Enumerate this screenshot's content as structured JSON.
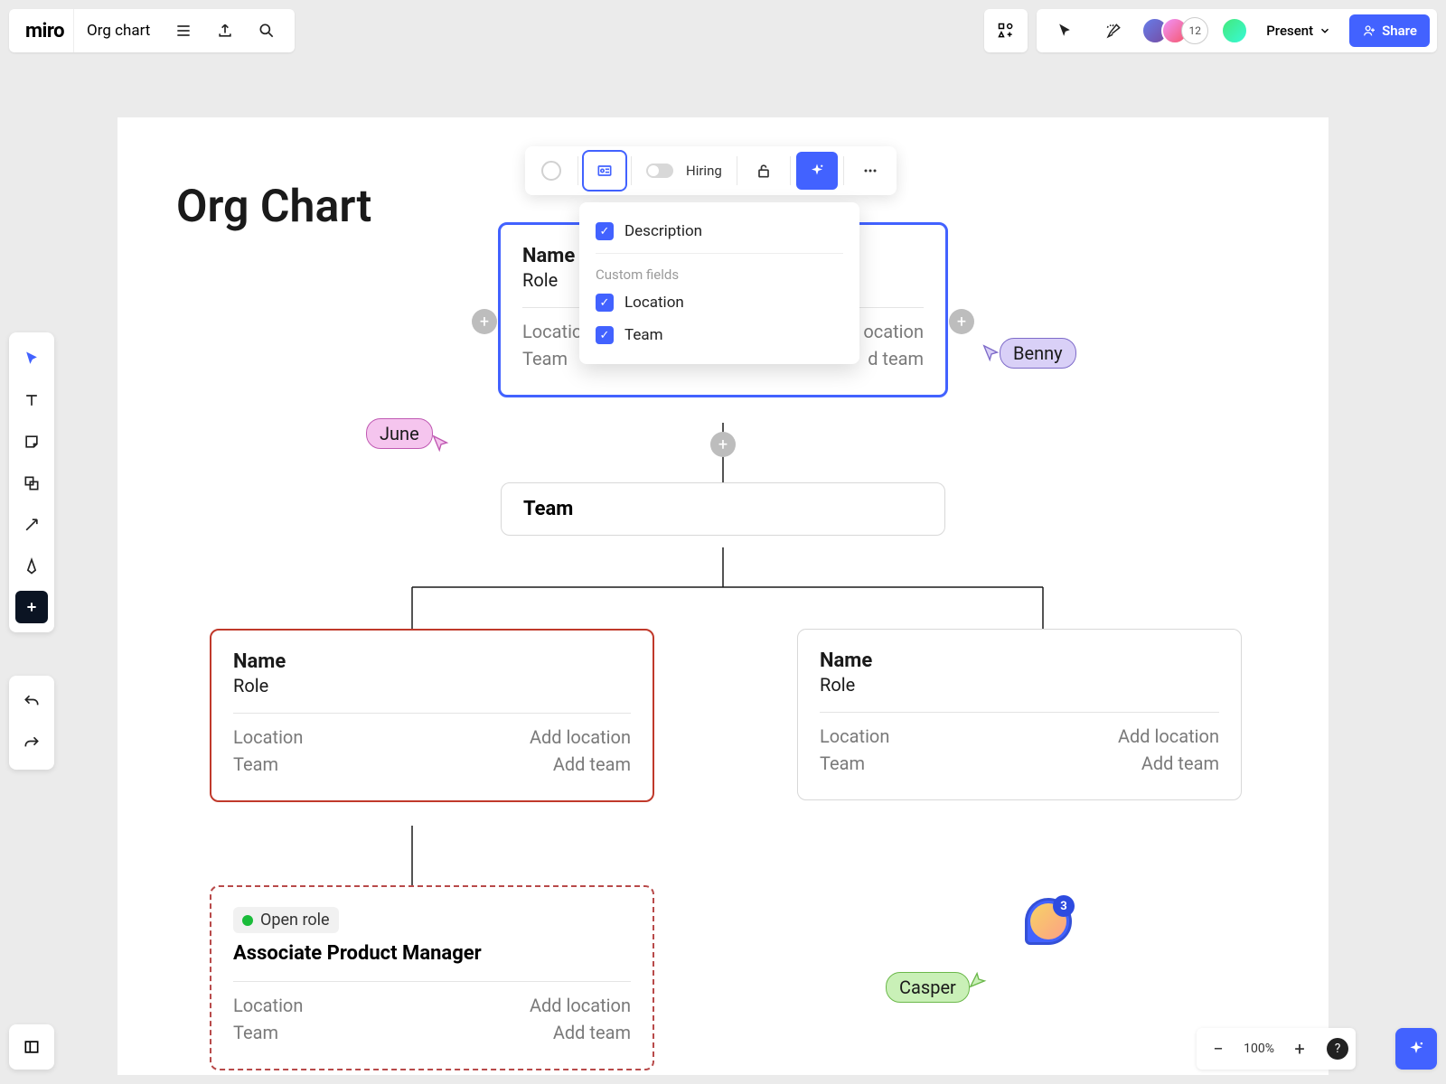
{
  "app": {
    "logo": "miro",
    "board_name": "Org chart"
  },
  "topbar": {
    "collaborator_count": "12",
    "present_label": "Present",
    "share_label": "Share"
  },
  "canvas": {
    "title": "Org Chart"
  },
  "node_toolbar": {
    "hiring_label": "Hiring"
  },
  "dropdown": {
    "description": "Description",
    "custom_fields_header": "Custom fields",
    "location": "Location",
    "team": "Team"
  },
  "nodes": {
    "root": {
      "name": "Name",
      "role": "Role",
      "location_label": "Locatio",
      "location_value": "ocation",
      "team_label": "Team",
      "team_value": "d team"
    },
    "team_node": {
      "label": "Team"
    },
    "left_child": {
      "name": "Name",
      "role": "Role",
      "location_label": "Location",
      "location_value": "Add location",
      "team_label": "Team",
      "team_value": "Add team"
    },
    "right_child": {
      "name": "Name",
      "role": "Role",
      "location_label": "Location",
      "location_value": "Add location",
      "team_label": "Team",
      "team_value": "Add team"
    },
    "open_role": {
      "badge": "Open role",
      "title": "Associate Product Manager",
      "location_label": "Location",
      "location_value": "Add location",
      "team_label": "Team",
      "team_value": "Add team"
    }
  },
  "cursors": {
    "june": "June",
    "benny": "Benny",
    "casper": "Casper"
  },
  "comments": {
    "count": "3"
  },
  "zoom": {
    "value": "100%"
  }
}
